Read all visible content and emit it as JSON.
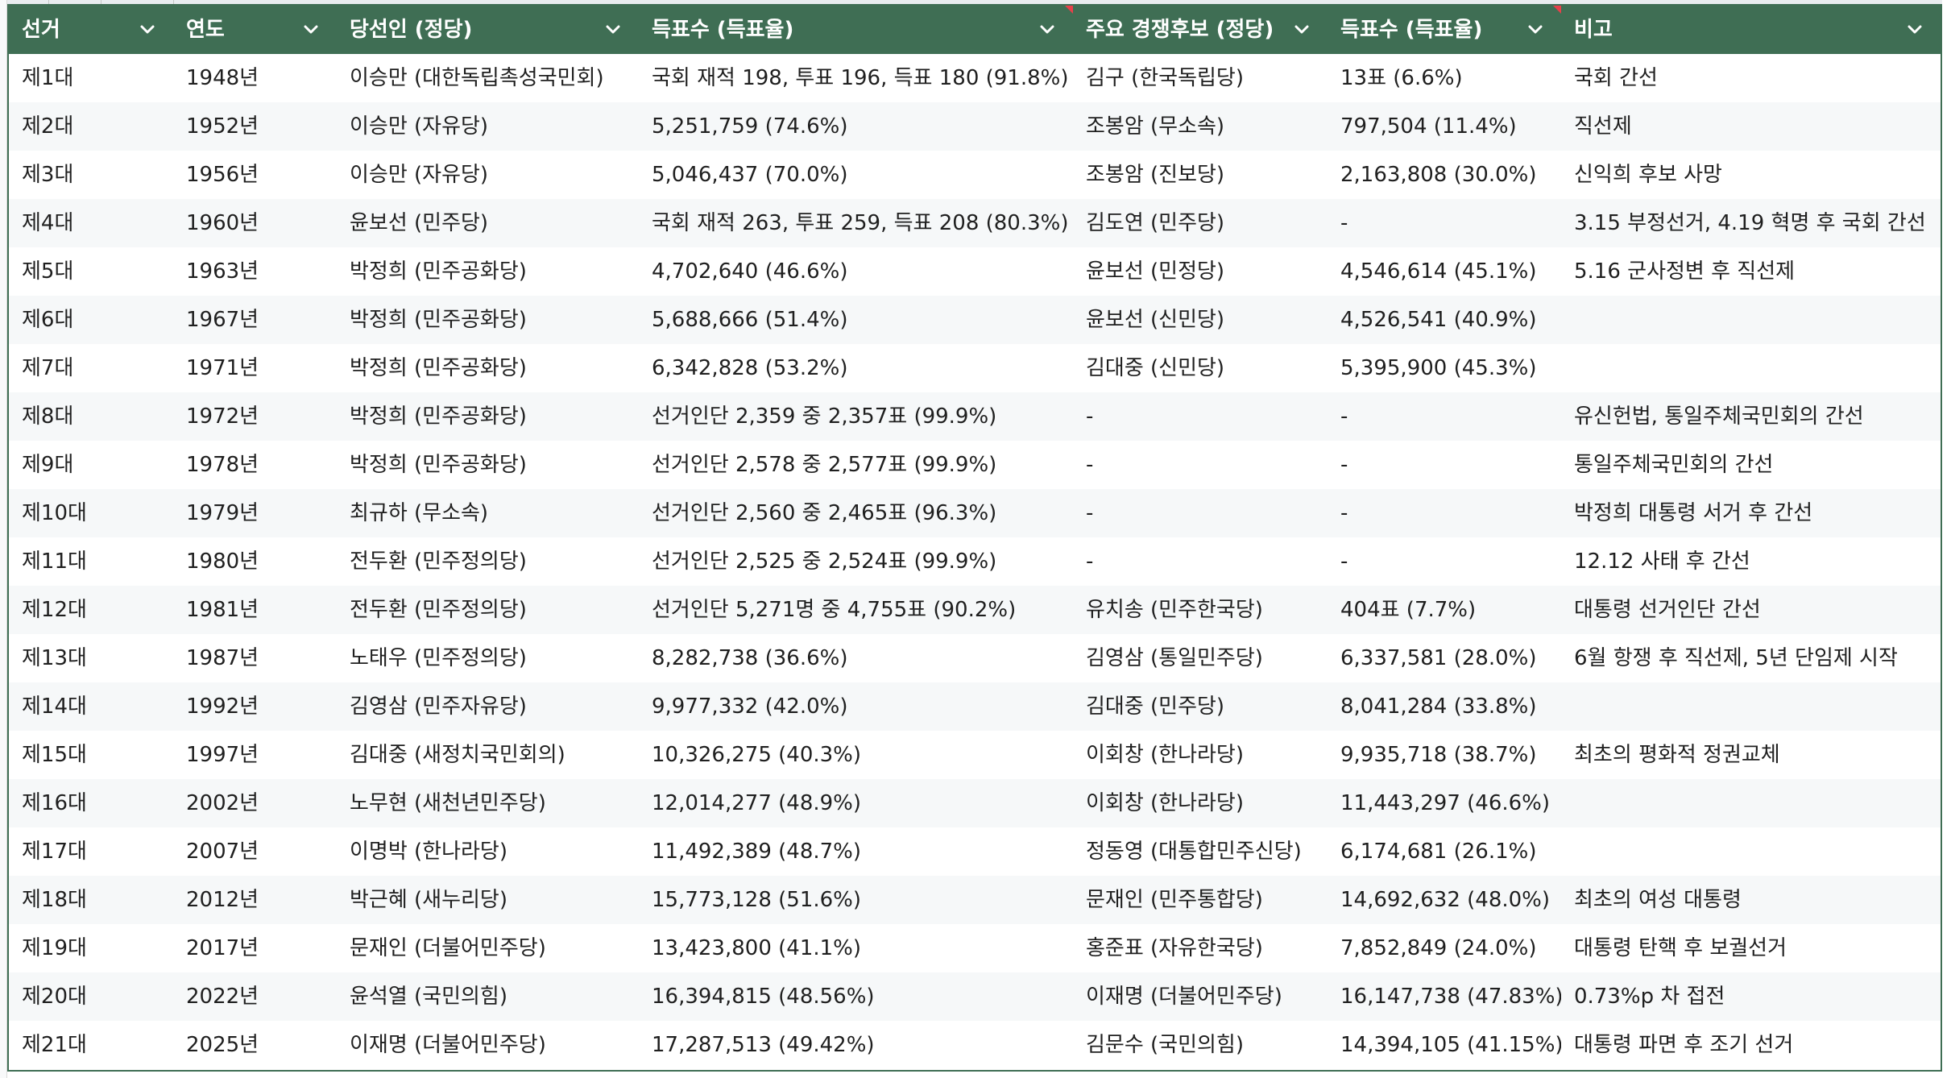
{
  "columns": [
    "선거",
    "연도",
    "당선인 (정당)",
    "득표수 (득표율)",
    "주요 경쟁후보 (정당)",
    "득표수 (득표율)",
    "비고"
  ],
  "colors": {
    "header_bg": "#3f6e54",
    "header_text": "#ffffff",
    "note_marker": "#e8404a",
    "band_row": "#f6f8f9"
  },
  "rows": [
    [
      "제1대",
      "1948년",
      "이승만 (대한독립촉성국민회)",
      "국회 재적 198, 투표 196, 득표 180 (91.8%)",
      "김구 (한국독립당)",
      "13표 (6.6%)",
      "국회 간선"
    ],
    [
      "제2대",
      "1952년",
      "이승만 (자유당)",
      "5,251,759 (74.6%)",
      "조봉암 (무소속)",
      "797,504 (11.4%)",
      "직선제"
    ],
    [
      "제3대",
      "1956년",
      "이승만 (자유당)",
      "5,046,437 (70.0%)",
      "조봉암 (진보당)",
      "2,163,808 (30.0%)",
      "신익희 후보 사망"
    ],
    [
      "제4대",
      "1960년",
      "윤보선 (민주당)",
      "국회 재적 263, 투표 259, 득표 208 (80.3%)",
      "김도연 (민주당)",
      "-",
      "3.15 부정선거, 4.19 혁명 후 국회 간선"
    ],
    [
      "제5대",
      "1963년",
      "박정희 (민주공화당)",
      "4,702,640 (46.6%)",
      "윤보선 (민정당)",
      "4,546,614 (45.1%)",
      "5.16 군사정변 후 직선제"
    ],
    [
      "제6대",
      "1967년",
      "박정희 (민주공화당)",
      "5,688,666 (51.4%)",
      "윤보선 (신민당)",
      "4,526,541 (40.9%)",
      ""
    ],
    [
      "제7대",
      "1971년",
      "박정희 (민주공화당)",
      "6,342,828 (53.2%)",
      "김대중 (신민당)",
      "5,395,900 (45.3%)",
      ""
    ],
    [
      "제8대",
      "1972년",
      "박정희 (민주공화당)",
      "선거인단 2,359 중 2,357표 (99.9%)",
      "-",
      "-",
      "유신헌법, 통일주체국민회의 간선"
    ],
    [
      "제9대",
      "1978년",
      "박정희 (민주공화당)",
      "선거인단 2,578 중 2,577표 (99.9%)",
      "-",
      "-",
      "통일주체국민회의 간선"
    ],
    [
      "제10대",
      "1979년",
      "최규하 (무소속)",
      "선거인단 2,560 중 2,465표 (96.3%)",
      "-",
      "-",
      "박정희 대통령 서거 후 간선"
    ],
    [
      "제11대",
      "1980년",
      "전두환 (민주정의당)",
      "선거인단 2,525 중 2,524표 (99.9%)",
      "-",
      "-",
      "12.12 사태 후 간선"
    ],
    [
      "제12대",
      "1981년",
      "전두환 (민주정의당)",
      "선거인단 5,271명 중 4,755표 (90.2%)",
      "유치송 (민주한국당)",
      "404표 (7.7%)",
      "대통령 선거인단 간선"
    ],
    [
      "제13대",
      "1987년",
      "노태우 (민주정의당)",
      "8,282,738 (36.6%)",
      "김영삼 (통일민주당)",
      "6,337,581 (28.0%)",
      "6월 항쟁 후 직선제, 5년 단임제 시작"
    ],
    [
      "제14대",
      "1992년",
      "김영삼 (민주자유당)",
      "9,977,332 (42.0%)",
      "김대중 (민주당)",
      "8,041,284 (33.8%)",
      ""
    ],
    [
      "제15대",
      "1997년",
      "김대중 (새정치국민회의)",
      "10,326,275 (40.3%)",
      "이회창 (한나라당)",
      "9,935,718 (38.7%)",
      "최초의 평화적 정권교체"
    ],
    [
      "제16대",
      "2002년",
      "노무현 (새천년민주당)",
      "12,014,277 (48.9%)",
      "이회창 (한나라당)",
      "11,443,297 (46.6%)",
      ""
    ],
    [
      "제17대",
      "2007년",
      "이명박 (한나라당)",
      "11,492,389 (48.7%)",
      "정동영 (대통합민주신당)",
      "6,174,681 (26.1%)",
      ""
    ],
    [
      "제18대",
      "2012년",
      "박근혜 (새누리당)",
      "15,773,128 (51.6%)",
      "문재인 (민주통합당)",
      "14,692,632 (48.0%)",
      "최초의 여성 대통령"
    ],
    [
      "제19대",
      "2017년",
      "문재인 (더불어민주당)",
      "13,423,800 (41.1%)",
      "홍준표 (자유한국당)",
      "7,852,849 (24.0%)",
      "대통령 탄핵 후 보궐선거"
    ],
    [
      "제20대",
      "2022년",
      "윤석열 (국민의힘)",
      "16,394,815 (48.56%)",
      "이재명 (더불어민주당)",
      "16,147,738 (47.83%)",
      "0.73%p 차 접전"
    ],
    [
      "제21대",
      "2025년",
      "이재명 (더불어민주당)",
      "17,287,513 (49.42%)",
      "김문수 (국민의힘)",
      "14,394,105 (41.15%)",
      "대통령 파면 후 조기 선거"
    ]
  ]
}
